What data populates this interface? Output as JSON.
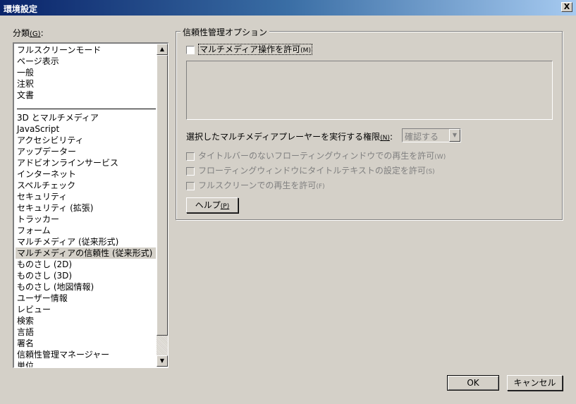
{
  "window": {
    "title": "環境設定",
    "close_glyph": "X"
  },
  "categories": {
    "label": "分類",
    "accel": "G",
    "label_suffix": ":",
    "group1": [
      "フルスクリーンモード",
      "ページ表示",
      "一般",
      "注釈",
      "文書"
    ],
    "group2": [
      {
        "text": "3D とマルチメディア"
      },
      {
        "text": "JavaScript"
      },
      {
        "text": "アクセシビリティ"
      },
      {
        "text": "アップデーター"
      },
      {
        "text": "アドビオンラインサービス"
      },
      {
        "text": "インターネット"
      },
      {
        "text": "スペルチェック"
      },
      {
        "text": "セキュリティ"
      },
      {
        "text": "セキュリティ (拡張)"
      },
      {
        "text": "トラッカー"
      },
      {
        "text": "フォーム"
      },
      {
        "text": "マルチメディア (従来形式)"
      },
      {
        "text": "マルチメディアの信頼性 (従来形式)",
        "selected": true
      },
      {
        "text": "ものさし (2D)"
      },
      {
        "text": "ものさし (3D)"
      },
      {
        "text": "ものさし (地図情報)"
      },
      {
        "text": "ユーザー情報"
      },
      {
        "text": "レビュー"
      },
      {
        "text": "検索"
      },
      {
        "text": "言語"
      },
      {
        "text": "署名"
      },
      {
        "text": "信頼性管理マネージャー"
      },
      {
        "text": "単位"
      }
    ]
  },
  "trust": {
    "group_title": "信頼性管理オプション",
    "allow_multimedia": {
      "label": "マルチメディア操作を許可",
      "accel": "(M)",
      "checked": false
    },
    "player_permission_label": "選択したマルチメディアプレーヤーを実行する権限",
    "player_permission_accel": "(N)",
    "player_permission_suffix": ":",
    "player_permission_value": "確認する",
    "options": [
      {
        "label": "タイトルバーのないフローティングウィンドウでの再生を許可",
        "accel": "(W)",
        "checked": false
      },
      {
        "label": "フローティングウィンドウにタイトルテキストの設定を許可",
        "accel": "(S)",
        "checked": false
      },
      {
        "label": "フルスクリーンでの再生を許可",
        "accel": "(F)",
        "checked": false
      }
    ],
    "help_label": "ヘルプ",
    "help_accel": "(P)"
  },
  "footer": {
    "ok_label": "OK",
    "cancel_label": "キャンセル"
  }
}
